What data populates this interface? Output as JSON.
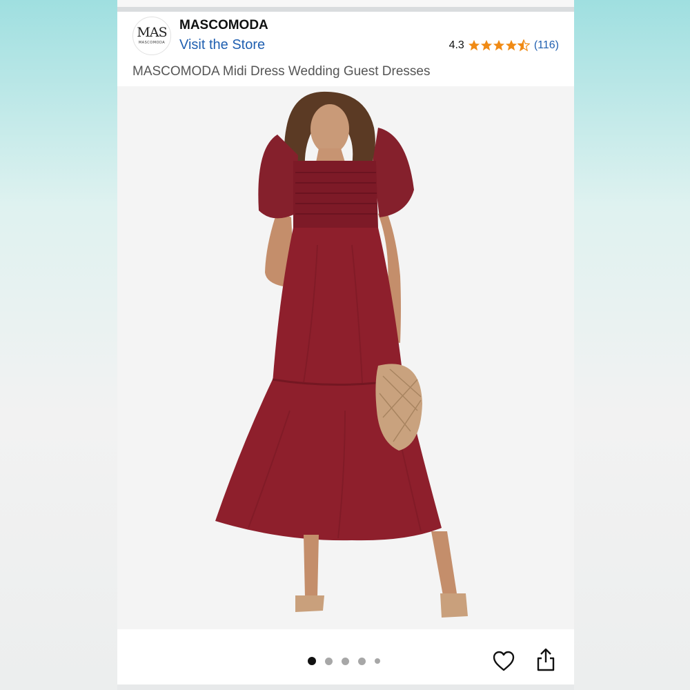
{
  "store": {
    "logo_text": "MAS",
    "logo_subtext": "MASCOMODA",
    "brand_name": "MASCOMODA",
    "visit_link": "Visit the Store"
  },
  "rating": {
    "value": "4.3",
    "stars": 4.3,
    "count": "(116)",
    "star_color": "#f08a14"
  },
  "product": {
    "title": "MASCOMODA Midi Dress Wedding Guest Dresses",
    "dress_color": "#8e1f2c"
  },
  "carousel": {
    "total_dots": 5,
    "active_index": 0
  },
  "icons": {
    "favorite": "heart-icon",
    "share": "share-icon"
  }
}
